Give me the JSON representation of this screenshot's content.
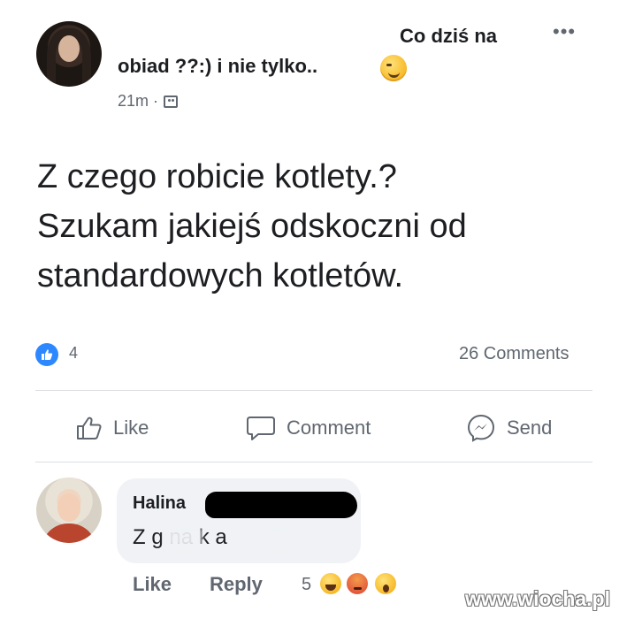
{
  "post": {
    "title_line1": "Co dziś na",
    "title_line2": "obiad ??:) i nie tylko..",
    "time": "21m ·",
    "body": "Z czego robicie kotlety.?\nSzukam jakiejś odskoczni od\nstandardowych kotletów.",
    "reactions_count": "4",
    "comments_count": "26 Comments"
  },
  "actions": {
    "like": "Like",
    "comment": "Comment",
    "send": "Send"
  },
  "comment": {
    "author": "Halina",
    "text": "Z g     na k    a",
    "like": "Like",
    "reply": "Reply",
    "reaction_count": "5",
    "reactions": [
      "haha-icon",
      "angry-icon",
      "wow-icon"
    ]
  },
  "watermark": "www.wiocha.pl",
  "colors": {
    "like_blue": "#2d88ff",
    "text_primary": "#1c1e21",
    "text_secondary": "#606770",
    "bubble_bg": "#f0f2f5"
  }
}
